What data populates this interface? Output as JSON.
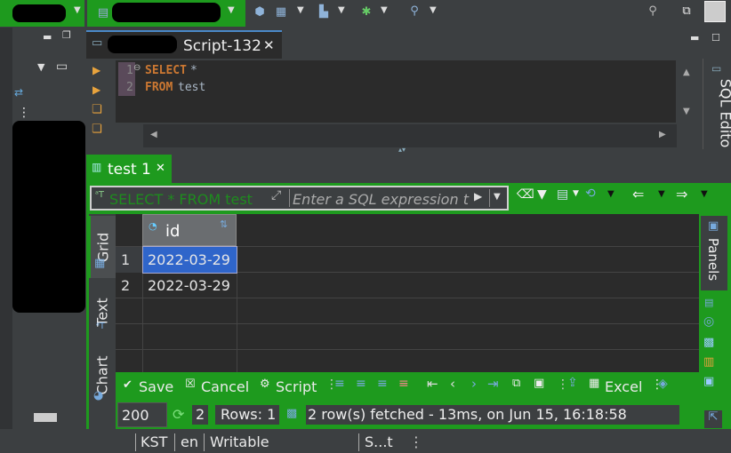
{
  "editor": {
    "tab_title": "Script-132",
    "lines": [
      {
        "num": "1",
        "keyword": "SELECT",
        "rest": " *"
      },
      {
        "num": "2",
        "keyword": "FROM",
        "rest": " test"
      }
    ],
    "side_tab": "SQL Edito"
  },
  "results": {
    "tab_title": "test 1",
    "filter_query": "SELECT * FROM test",
    "filter_placeholder": "Enter a SQL expression t",
    "column": "id",
    "rows": [
      {
        "n": "1",
        "value": "2022-03-29"
      },
      {
        "n": "2",
        "value": "2022-03-29"
      }
    ],
    "vtabs": {
      "grid": "Grid",
      "text": "Text",
      "chart": "Chart"
    },
    "panels": "Panels",
    "toolbar": {
      "save": "Save",
      "cancel": "Cancel",
      "script": "Script",
      "excel": "Excel"
    },
    "status": {
      "fetch_size": "200",
      "refresh_count": "2",
      "rows_label": "Rows: 1",
      "message": "2 row(s) fetched - 13ms, on Jun 15, 16:18:58"
    }
  },
  "statusbar": {
    "timezone": "KST",
    "locale": "en",
    "mode": "Writable",
    "smart": "S...t"
  },
  "colors": {
    "accent_green": "#1e9a1e",
    "selection": "#2f65ca",
    "dark_bg": "#2b2b2b"
  }
}
